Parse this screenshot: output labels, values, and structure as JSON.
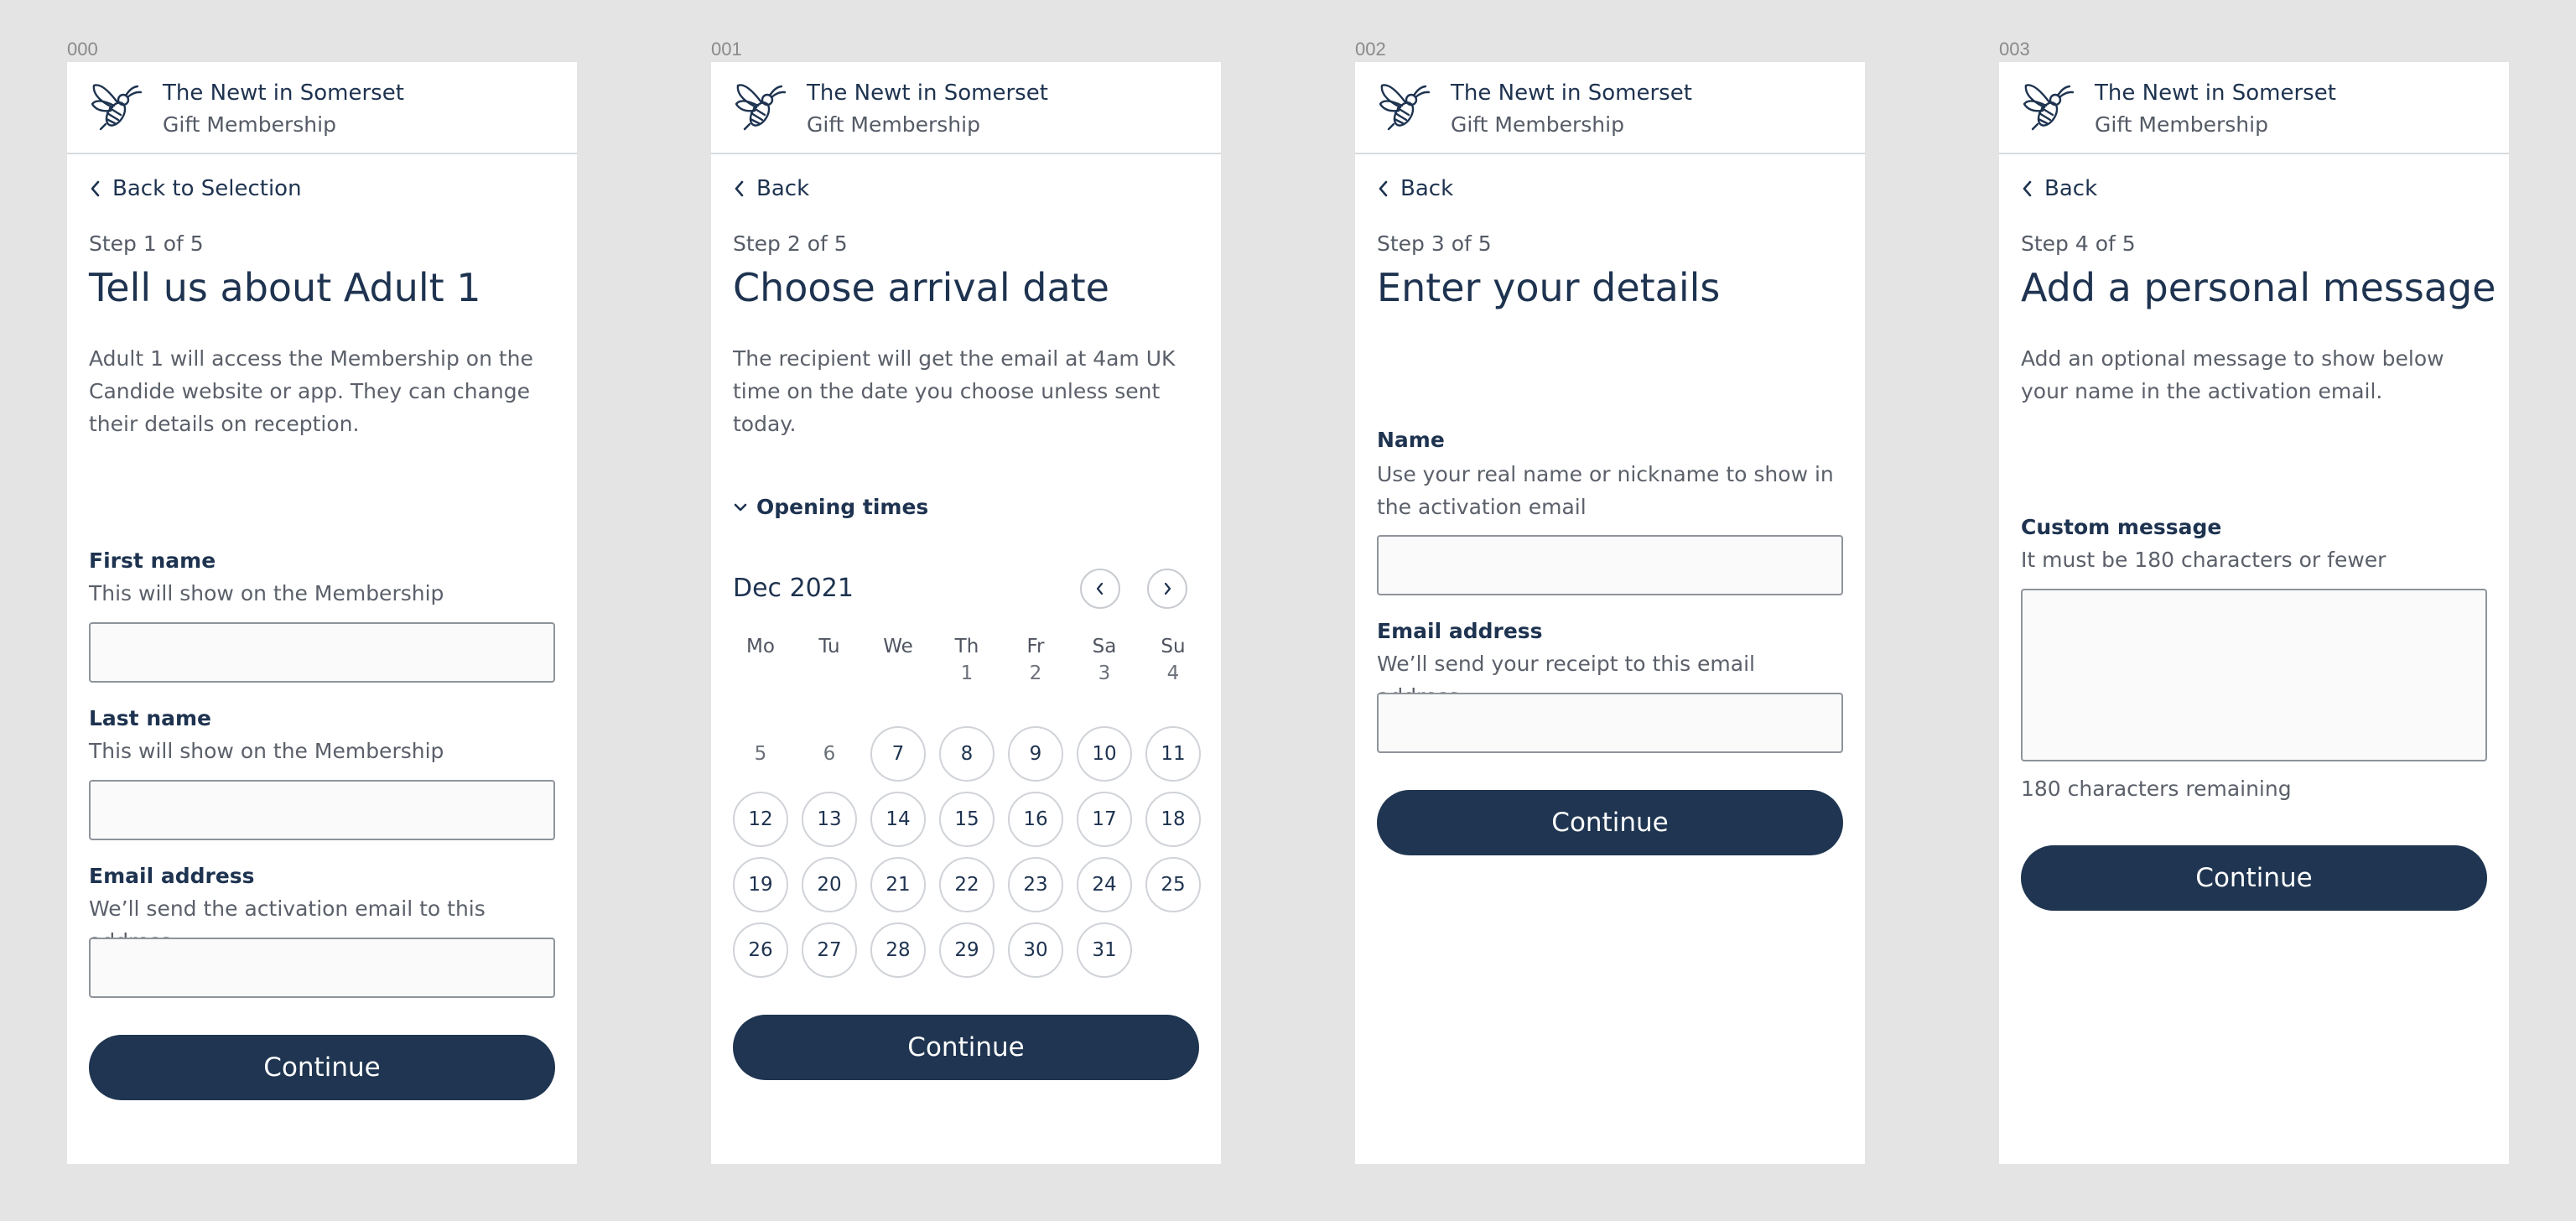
{
  "app": {
    "title": "The Newt in Somerset",
    "subtitle": "Gift Membership"
  },
  "colors": {
    "navy": "#1f3551",
    "text": "#1e3350",
    "muted": "#5b606a",
    "background": "#e4e4e4"
  },
  "screens": [
    {
      "frame_label": "000",
      "back_label": "Back to Selection",
      "step": "Step 1 of 5",
      "title": "Tell us about Adult 1",
      "description": "Adult 1 will access the Membership on the Candide website or app. They can change their details on reception.",
      "fields": [
        {
          "label": "First name",
          "hint": "This will show on the Membership",
          "value": ""
        },
        {
          "label": "Last name",
          "hint": "This will show on the Membership",
          "value": ""
        },
        {
          "label": "Email address",
          "hint": "We’ll send the activation email to this address",
          "value": ""
        }
      ],
      "button": "Continue"
    },
    {
      "frame_label": "001",
      "back_label": "Back",
      "step": "Step 2 of 5",
      "title": "Choose arrival date",
      "description": "The recipient will get the email at 4am UK time on the date you choose unless sent today.",
      "toggle_label": "Opening times",
      "calendar": {
        "month_label": "Dec 2021",
        "weekdays": [
          "Mo",
          "Tu",
          "We",
          "Th",
          "Fr",
          "Sa",
          "Su"
        ],
        "first_weekday_index": 3,
        "days_in_month": 31,
        "unavailable_days": [
          1,
          2,
          3,
          4,
          5,
          6
        ]
      },
      "button": "Continue"
    },
    {
      "frame_label": "002",
      "back_label": "Back",
      "step": "Step 3 of 5",
      "title": "Enter your details",
      "fields": [
        {
          "label": "Name",
          "hint": "Use your real name or nickname to show in the activation email",
          "value": ""
        },
        {
          "label": "Email address",
          "hint": "We’ll send your receipt to this email address",
          "value": ""
        }
      ],
      "button": "Continue"
    },
    {
      "frame_label": "003",
      "back_label": "Back",
      "step": "Step 4 of 5",
      "title": "Add a personal message",
      "description": "Add an optional message to show below your name in the activation email.",
      "field": {
        "label": "Custom message",
        "hint": "It must be 180 characters or fewer",
        "value": ""
      },
      "remaining": "180 characters remaining",
      "button": "Continue"
    }
  ]
}
